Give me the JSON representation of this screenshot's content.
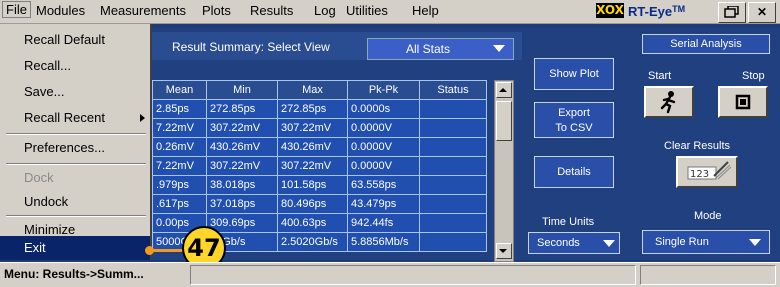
{
  "menubar": {
    "items": [
      "File",
      "Modules",
      "Measurements",
      "Plots",
      "Results",
      "Log",
      "Utilities",
      "Help"
    ],
    "logo_box": "XOX",
    "logo_text": "RT-Eye",
    "logo_sup": "TM"
  },
  "file_menu": {
    "items": [
      "Recall Default",
      "Recall...",
      "Save...",
      "Recall Recent",
      "Preferences...",
      "Dock",
      "Undock",
      "Minimize",
      "Exit"
    ]
  },
  "result_summary": {
    "label": "Result Summary: Select View",
    "view_selected": "All Stats",
    "columns": [
      "Mean",
      "Min",
      "Max",
      "Pk-Pk",
      "Status"
    ],
    "rows": [
      [
        "2.85ps",
        "272.85ps",
        "272.85ps",
        "0.0000s",
        ""
      ],
      [
        "7.22mV",
        "307.22mV",
        "307.22mV",
        "0.0000V",
        ""
      ],
      [
        "0.26mV",
        "430.26mV",
        "430.26mV",
        "0.0000V",
        ""
      ],
      [
        "7.22mV",
        "307.22mV",
        "307.22mV",
        "0.0000V",
        ""
      ],
      [
        ".979ps",
        "38.018ps",
        "101.58ps",
        "63.558ps",
        ""
      ],
      [
        ".617ps",
        "37.018ps",
        "80.496ps",
        "43.479ps",
        ""
      ],
      [
        "0.00ps",
        "309.69ps",
        "400.63ps",
        "942.44fs",
        ""
      ],
      [
        "5000G",
        "51Gb/s",
        "2.5020Gb/s",
        "5.8856Mb/s",
        ""
      ]
    ]
  },
  "actions": {
    "show_plot": "Show Plot",
    "export_line1": "Export",
    "export_line2": "To CSV",
    "details": "Details",
    "time_units_label": "Time Units",
    "time_units_value": "Seconds"
  },
  "serial_analysis": {
    "title": "Serial Analysis",
    "start": "Start",
    "stop": "Stop",
    "clear_results": "Clear Results",
    "mode_label": "Mode",
    "mode_value": "Single Run"
  },
  "status_bar": {
    "text": "Menu: Results->Summ..."
  },
  "callout": {
    "number": "47"
  },
  "colors": {
    "panel": "#21407f",
    "cell": "#214fb0",
    "highlight": "#0a246a",
    "callout": "#ffd52a",
    "callout_line": "#f39a1e"
  }
}
